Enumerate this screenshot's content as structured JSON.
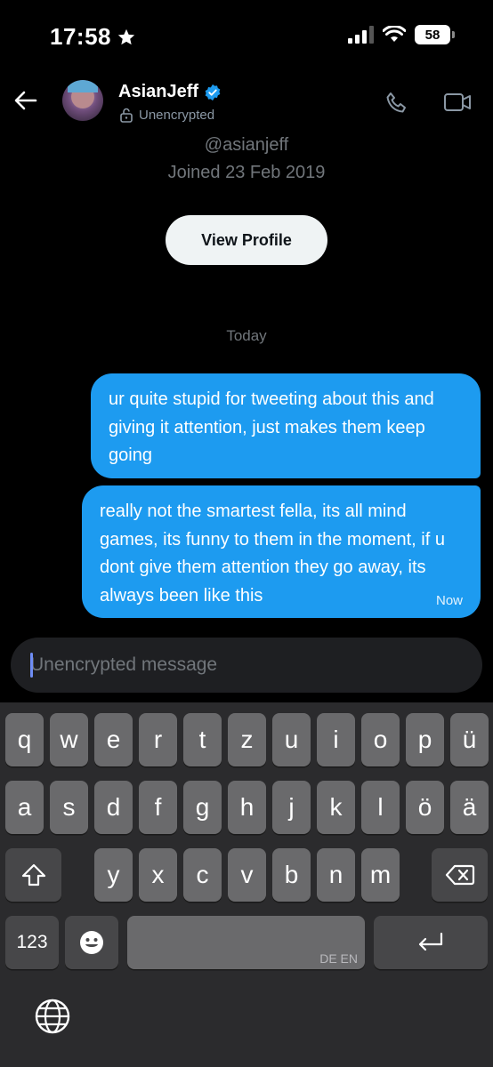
{
  "status_bar": {
    "time": "17:58",
    "battery": "58"
  },
  "header": {
    "name": "AsianJeff",
    "encryption_label": "Unencrypted"
  },
  "profile": {
    "handle": "@asianjeff",
    "joined": "Joined 23 Feb 2019",
    "view_profile_label": "View Profile"
  },
  "conversation": {
    "day_label": "Today",
    "messages": [
      {
        "text": "ur quite stupid for tweeting about this and giving it attention, just makes them keep going",
        "time": ""
      },
      {
        "text": "really not the smartest fella, its all mind games, its funny to them in the moment, if u dont give them attention they go away, its always been like this",
        "time": "Now"
      }
    ]
  },
  "composer": {
    "placeholder": "Unencrypted message"
  },
  "keyboard": {
    "row1": [
      "q",
      "w",
      "e",
      "r",
      "t",
      "z",
      "u",
      "i",
      "o",
      "p",
      "ü"
    ],
    "row2": [
      "a",
      "s",
      "d",
      "f",
      "g",
      "h",
      "j",
      "k",
      "l",
      "ö",
      "ä"
    ],
    "row3": [
      "y",
      "x",
      "c",
      "v",
      "b",
      "n",
      "m"
    ],
    "numbers_label": "123",
    "space_languages": "DE EN"
  },
  "colors": {
    "accent": "#1d9bf0",
    "background": "#000000",
    "keyboard": "#2b2b2d"
  }
}
